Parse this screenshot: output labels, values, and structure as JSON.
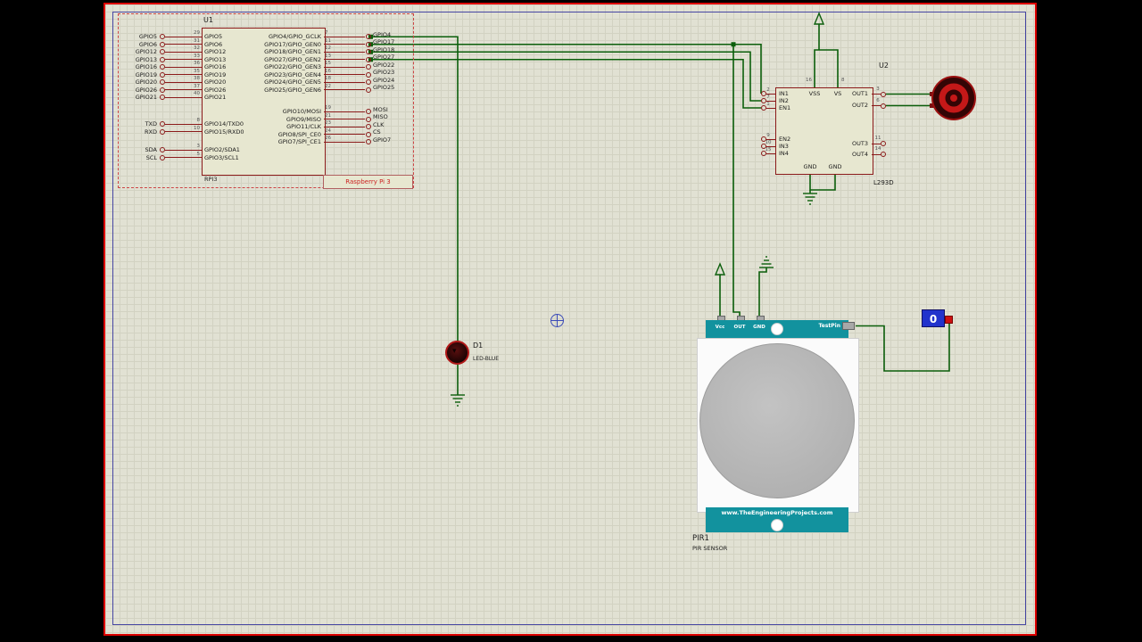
{
  "schematic": {
    "rpi": {
      "ref": "U1",
      "footer": "RPI3",
      "part_label": "Raspberry Pi 3",
      "left_groups": [
        [
          {
            "outer": "GPIO5",
            "num": "29",
            "inner": "GPIO5"
          },
          {
            "outer": "GPIO6",
            "num": "31",
            "inner": "GPIO6"
          },
          {
            "outer": "GPIO12",
            "num": "32",
            "inner": "GPIO12"
          },
          {
            "outer": "GPIO13",
            "num": "33",
            "inner": "GPIO13"
          },
          {
            "outer": "GPIO16",
            "num": "36",
            "inner": "GPIO16"
          },
          {
            "outer": "GPIO19",
            "num": "35",
            "inner": "GPIO19"
          },
          {
            "outer": "GPIO20",
            "num": "38",
            "inner": "GPIO20"
          },
          {
            "outer": "GPIO26",
            "num": "37",
            "inner": "GPIO26"
          },
          {
            "outer": "GPIO21",
            "num": "40",
            "inner": "GPIO21"
          }
        ],
        [
          {
            "outer": "TXD",
            "num": "8",
            "inner": "GPIO14/TXD0"
          },
          {
            "outer": "RXD",
            "num": "10",
            "inner": "GPIO15/RXD0"
          }
        ],
        [
          {
            "outer": "SDA",
            "num": "3",
            "inner": "GPIO2/SDA1"
          },
          {
            "outer": "SCL",
            "num": "5",
            "inner": "GPIO3/SCL1"
          }
        ]
      ],
      "right_groups": [
        [
          {
            "inner": "GPIO4/GPIO_GCLK",
            "num": "7",
            "outer": "GPIO4"
          },
          {
            "inner": "GPIO17/GPIO_GEN0",
            "num": "11",
            "outer": "GPIO17"
          },
          {
            "inner": "GPIO18/GPIO_GEN1",
            "num": "12",
            "outer": "GPIO18"
          },
          {
            "inner": "GPIO27/GPIO_GEN2",
            "num": "13",
            "outer": "GPIO27"
          },
          {
            "inner": "GPIO22/GPIO_GEN3",
            "num": "15",
            "outer": "GPIO22"
          },
          {
            "inner": "GPIO23/GPIO_GEN4",
            "num": "16",
            "outer": "GPIO23"
          },
          {
            "inner": "GPIO24/GPIO_GEN5",
            "num": "18",
            "outer": "GPIO24"
          },
          {
            "inner": "GPIO25/GPIO_GEN6",
            "num": "22",
            "outer": "GPIO25"
          }
        ],
        [
          {
            "inner": "GPIO10/MOSI",
            "num": "19",
            "outer": "MOSI"
          },
          {
            "inner": "GPIO9/MISO",
            "num": "21",
            "outer": "MISO"
          },
          {
            "inner": "GPIO11/CLK",
            "num": "23",
            "outer": "CLK"
          },
          {
            "inner": "GPIO8/SPI_CE0",
            "num": "24",
            "outer": "CS"
          },
          {
            "inner": "GPIO7/SPI_CE1",
            "num": "26",
            "outer": "GPIO7"
          }
        ]
      ]
    },
    "l293d": {
      "ref": "U2",
      "value": "L293D",
      "left_groups": [
        [
          {
            "num": "2",
            "name": "IN1"
          },
          {
            "num": "7",
            "name": "IN2"
          },
          {
            "num": "1",
            "name": "EN1"
          }
        ],
        [
          {
            "num": "9",
            "name": "EN2"
          },
          {
            "num": "10",
            "name": "IN3"
          },
          {
            "num": "15",
            "name": "IN4"
          }
        ]
      ],
      "right_groups": [
        [
          {
            "num": "3",
            "name": "OUT1"
          },
          {
            "num": "6",
            "name": "OUT2"
          }
        ],
        [
          {
            "num": "11",
            "name": "OUT3"
          },
          {
            "num": "14",
            "name": "OUT4"
          }
        ]
      ],
      "top_pins": [
        {
          "num": "16",
          "name": "VSS"
        },
        {
          "num": "8",
          "name": "VS"
        }
      ],
      "bottom_pins": [
        "GND",
        "GND"
      ]
    },
    "led": {
      "ref": "D1",
      "value": "LED-BLUE"
    },
    "pir": {
      "ref": "PIR1",
      "value": "PIR SENSOR",
      "pins": [
        "Vcc",
        "OUT",
        "GND"
      ],
      "testpin_label": "TestPin",
      "url_label": "www.TheEngineeringProjects.com"
    },
    "logic_state": {
      "value": "0"
    }
  },
  "colors": {
    "wire": "#0b5e0b",
    "outline": "#8b1a1a",
    "body_fill": "#e7e7d0",
    "canvas_bg": "#e1e1d3",
    "grid_line": "#d2d2c2",
    "sheet_border": "#4646a2",
    "frame_red": "#dd0000",
    "teal": "#12929e",
    "blue_box": "#2233cc",
    "terminal_red": "#cc1111",
    "text_dark": "#1a1a1a",
    "pin_num": "#555555",
    "part_red": "#cc2222"
  }
}
